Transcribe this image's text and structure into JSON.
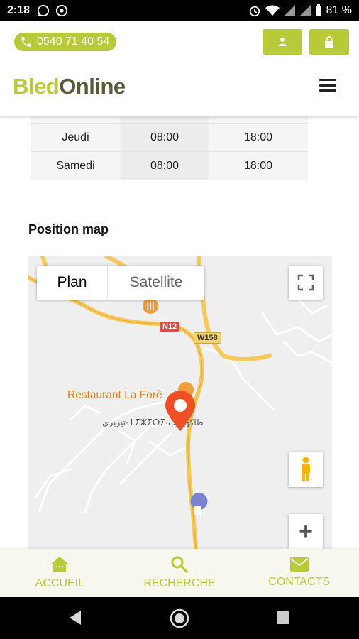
{
  "status_bar": {
    "time": "2:18",
    "battery_percent": "81 %"
  },
  "header": {
    "phone": "0540 71 40 54",
    "logo_part1": "Bled",
    "logo_part2": "Online"
  },
  "hours_table": {
    "rows": [
      {
        "day": "Jeudi",
        "open": "08:00",
        "close": "18:00"
      },
      {
        "day": "Samedi",
        "open": "08:00",
        "close": "18:00"
      }
    ]
  },
  "map_section": {
    "title": "Position map",
    "map_types": {
      "plan": "Plan",
      "satellite": "Satellite"
    },
    "labels": {
      "restaurant": "Restaurant La Forê",
      "village": "تيزيري·ⵜⵉⵣⵉⵔⵉ·طاكهبيرت",
      "road_n12": "N12",
      "road_w158": "W158"
    },
    "zoom_in_label": "+"
  },
  "bottom_nav": {
    "items": [
      {
        "label": "ACCUEIL",
        "icon": "home-icon"
      },
      {
        "label": "RECHERCHE",
        "icon": "search-icon"
      },
      {
        "label": "CONTACTS",
        "icon": "mail-icon"
      }
    ]
  },
  "colors": {
    "brand": "#b8c93a",
    "brand_dark": "#5a5a3a",
    "pin": "#f04e23"
  }
}
